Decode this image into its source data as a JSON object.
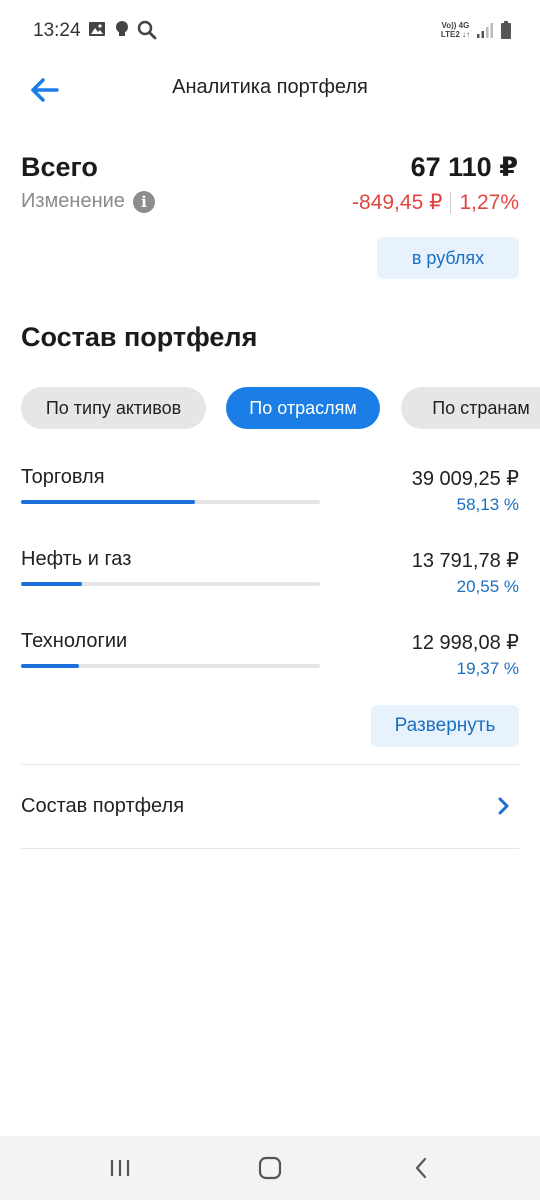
{
  "status_bar": {
    "time": "13:24",
    "network_top": "Vo)) 4G",
    "network_bottom": "LTE2 ↓↑"
  },
  "header": {
    "title": "Аналитика портфеля",
    "back_icon": "arrow-left-icon"
  },
  "summary": {
    "total_label": "Всего",
    "total_value": "67 110 ₽",
    "change_label": "Изменение",
    "info_icon_glyph": "i",
    "change_amount": "-849,45 ₽",
    "change_percent": "1,27%",
    "currency_button": "в рублях"
  },
  "composition": {
    "title": "Состав портфеля",
    "tabs": [
      {
        "label": "По типу активов",
        "active": false
      },
      {
        "label": "По отраслям",
        "active": true
      },
      {
        "label": "По странам",
        "active": false
      }
    ],
    "rows": [
      {
        "name": "Торговля",
        "amount": "39 009,25 ₽",
        "percent": "58,13 %",
        "share": 0.5813
      },
      {
        "name": "Нефть и газ",
        "amount": "13 791,78 ₽",
        "percent": "20,55 %",
        "share": 0.2055
      },
      {
        "name": "Технологии",
        "amount": "12 998,08 ₽",
        "percent": "19,37 %",
        "share": 0.1937
      }
    ],
    "expand_button": "Развернуть"
  },
  "link": {
    "label": "Состав портфеля"
  },
  "colors": {
    "accent": "#1a7ee6",
    "negative": "#e0463f",
    "secondary_bg": "#e8f2fc"
  }
}
